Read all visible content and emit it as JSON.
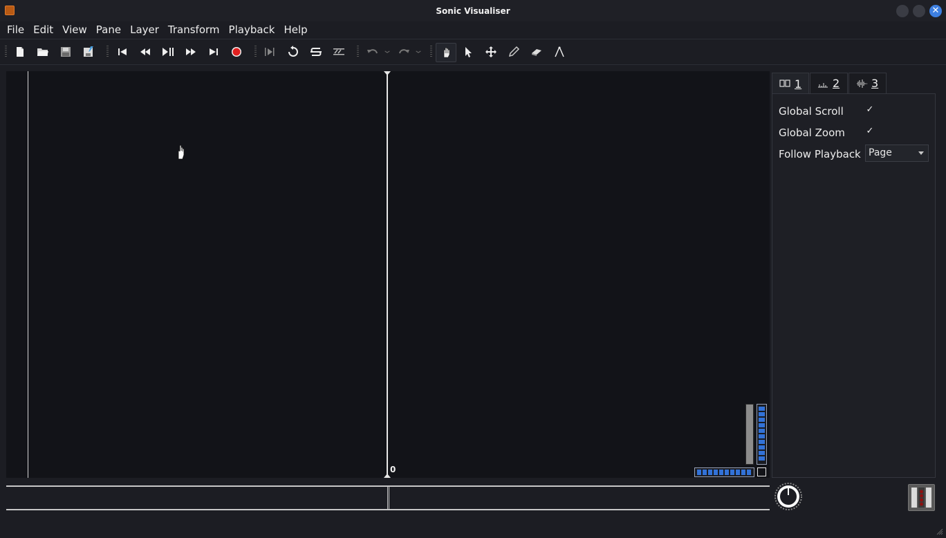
{
  "window": {
    "title": "Sonic Visualiser",
    "close_glyph": "✕"
  },
  "menu": [
    {
      "label": "File"
    },
    {
      "label": "Edit"
    },
    {
      "label": "View"
    },
    {
      "label": "Pane"
    },
    {
      "label": "Layer"
    },
    {
      "label": "Transform"
    },
    {
      "label": "Playback"
    },
    {
      "label": "Help"
    }
  ],
  "toolbar": {
    "icons": [
      "new-file-icon",
      "open-file-icon",
      "save-icon",
      "save-as-icon",
      "rewind-start-icon",
      "rewind-icon",
      "play-pause-icon",
      "fast-forward-icon",
      "fast-forward-end-icon",
      "record-icon",
      "play-selection-icon",
      "loop-icon",
      "solo-icon",
      "normalize-icon",
      "undo-icon",
      "redo-icon",
      "navigate-icon",
      "select-icon",
      "move-icon",
      "draw-icon",
      "erase-icon",
      "measure-icon"
    ],
    "active_tool": "navigate"
  },
  "pane": {
    "center_label": "0"
  },
  "tabs": [
    {
      "label": "1"
    },
    {
      "label": "2"
    },
    {
      "label": "3"
    }
  ],
  "properties": {
    "global_scroll": {
      "label": "Global Scroll",
      "checked": true,
      "mark": "✓"
    },
    "global_zoom": {
      "label": "Global Zoom",
      "checked": true,
      "mark": "✓"
    },
    "follow_playback": {
      "label": "Follow Playback",
      "value": "Page"
    }
  },
  "colors": {
    "accent": "#3272d8",
    "record": "#e02020",
    "background": "#1c1d23",
    "pane": "#121318"
  }
}
